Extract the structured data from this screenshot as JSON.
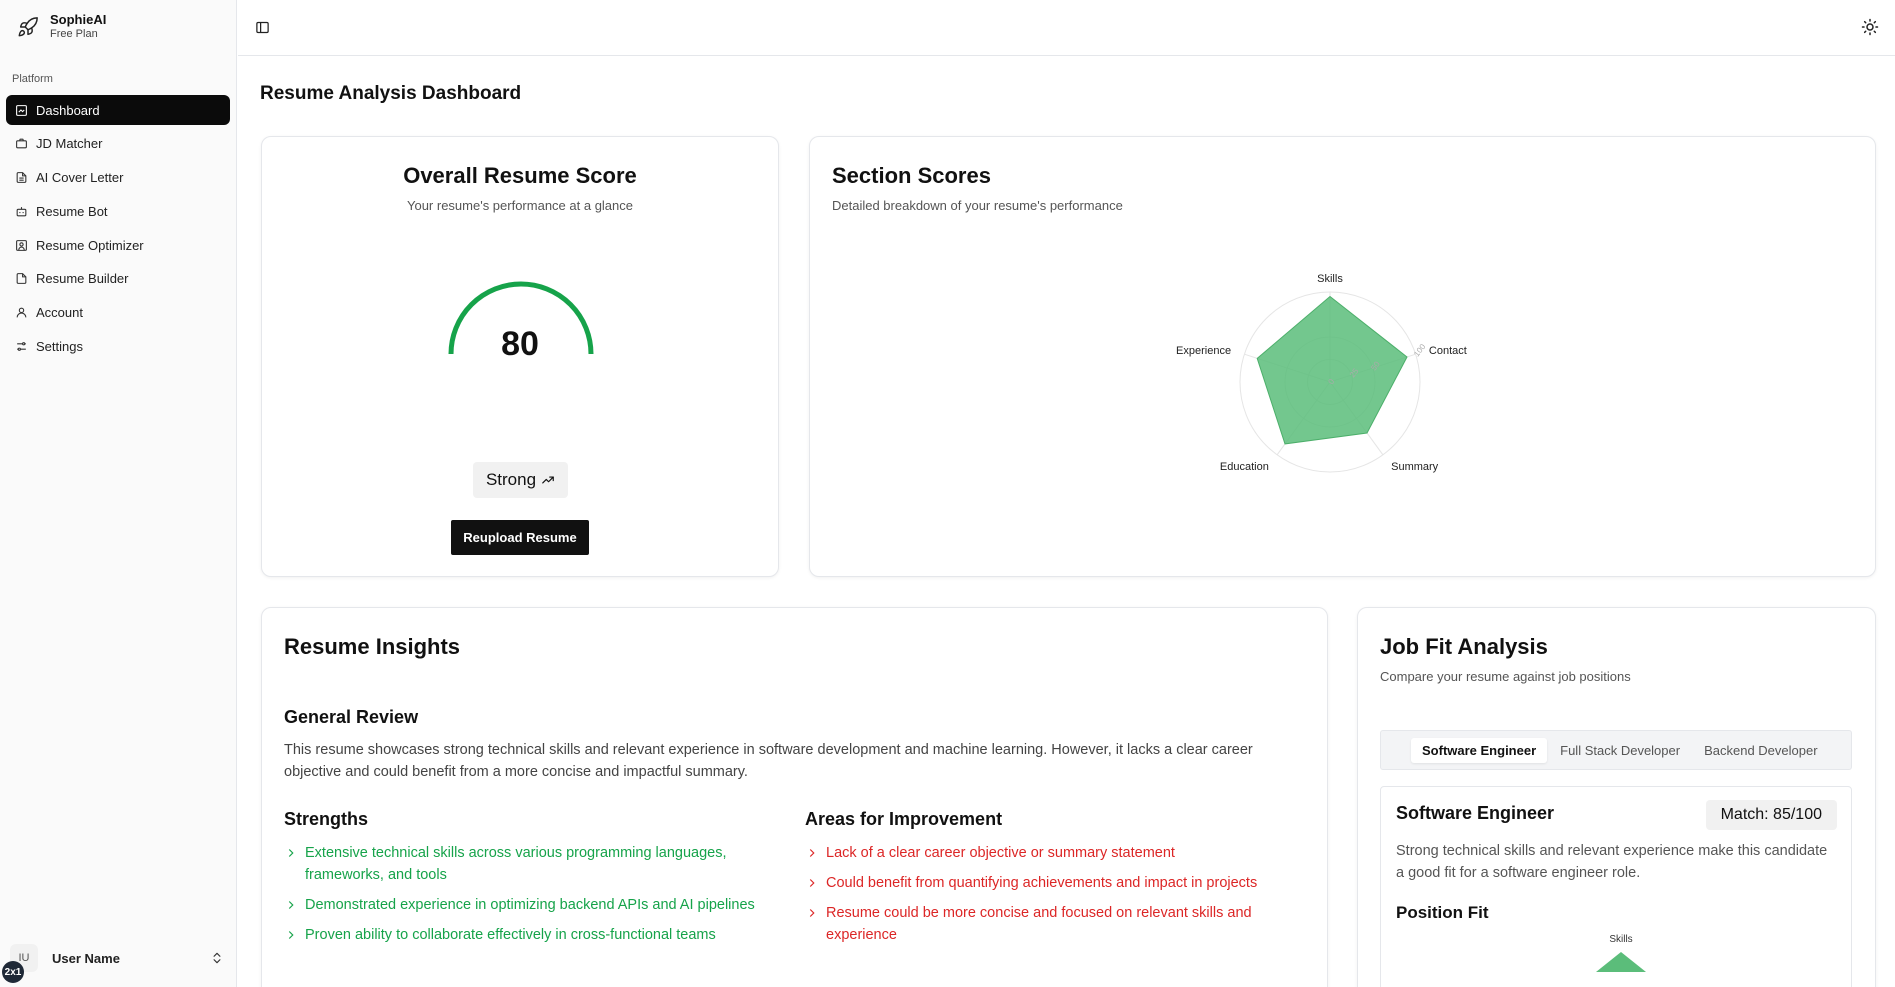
{
  "app": {
    "name": "SophieAI",
    "plan": "Free Plan"
  },
  "sidebar": {
    "group_label": "Platform",
    "items": [
      {
        "label": "Dashboard",
        "icon": "dashboard-icon",
        "active": true
      },
      {
        "label": "JD Matcher",
        "icon": "briefcase-icon",
        "active": false
      },
      {
        "label": "AI Cover Letter",
        "icon": "document-icon",
        "active": false
      },
      {
        "label": "Resume Bot",
        "icon": "bot-icon",
        "active": false
      },
      {
        "label": "Resume Optimizer",
        "icon": "user-square-icon",
        "active": false
      },
      {
        "label": "Resume Builder",
        "icon": "file-icon",
        "active": false
      },
      {
        "label": "Account",
        "icon": "user-icon",
        "active": false
      },
      {
        "label": "Settings",
        "icon": "sliders-icon",
        "active": false
      }
    ],
    "user": {
      "initials": "IU",
      "name": "User Name"
    }
  },
  "badge": "2x1",
  "page": {
    "title": "Resume Analysis Dashboard"
  },
  "score_card": {
    "title": "Overall Resume Score",
    "description": "Your resume's performance at a glance",
    "score": "80",
    "score_value": 80,
    "max": 100,
    "rating": "Strong",
    "button": "Reupload Resume",
    "gauge_color": "#16a34a"
  },
  "section_scores": {
    "title": "Section Scores",
    "description": "Detailed breakdown of your resume's performance"
  },
  "chart_data": {
    "type": "radar",
    "categories": [
      "Skills",
      "Contact",
      "Summary",
      "Education",
      "Experience"
    ],
    "values": [
      95,
      90,
      70,
      85,
      85
    ],
    "ylim": [
      0,
      100
    ],
    "tick_labels": [
      "0",
      "25",
      "50",
      "100"
    ],
    "fill_color": "#5bbd7a"
  },
  "insights": {
    "title": "Resume Insights",
    "general_review_title": "General Review",
    "general_review": "This resume showcases strong technical skills and relevant experience in software development and machine learning. However, it lacks a clear career objective and could benefit from a more concise and impactful summary.",
    "strengths_title": "Strengths",
    "strengths": [
      "Extensive technical skills across various programming languages, frameworks, and tools",
      "Demonstrated experience in optimizing backend APIs and AI pipelines",
      "Proven ability to collaborate effectively in cross-functional teams"
    ],
    "improvements_title": "Areas for Improvement",
    "improvements": [
      "Lack of a clear career objective or summary statement",
      "Could benefit from quantifying achievements and impact in projects",
      "Resume could be more concise and focused on relevant skills and experience"
    ],
    "strength_color": "#16a34a",
    "improvement_color": "#dc2626"
  },
  "job_fit": {
    "title": "Job Fit Analysis",
    "description": "Compare your resume against job positions",
    "tabs": [
      "Software Engineer",
      "Full Stack Developer",
      "Backend Developer"
    ],
    "active_tab": 0,
    "job": {
      "title": "Software Engineer",
      "match": "Match: 85/100",
      "description": "Strong technical skills and relevant experience make this candidate a good fit for a software engineer role.",
      "position_fit_title": "Position Fit",
      "radar_label": "Skills"
    }
  }
}
